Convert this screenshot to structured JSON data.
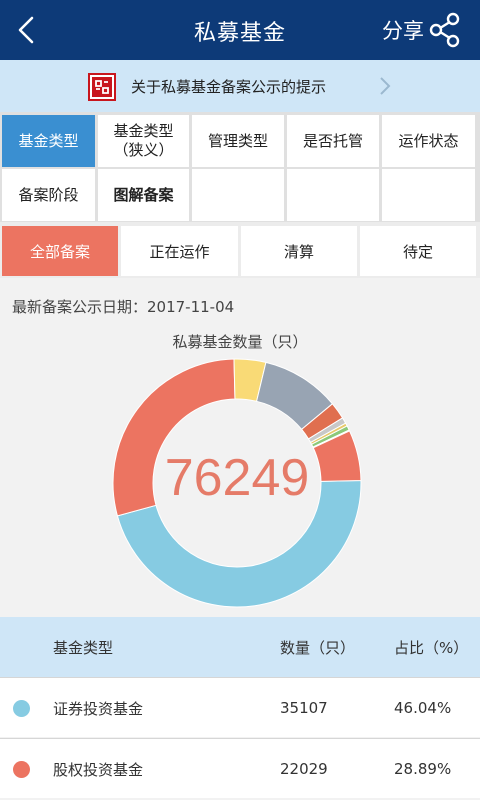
{
  "header": {
    "title": "私募基金",
    "share_label": "分享"
  },
  "notice": {
    "text": "关于私募基金备案公示的提示"
  },
  "category_tabs": [
    {
      "label": "基金类型",
      "active": true
    },
    {
      "label": "基金类型\n（狭义）"
    },
    {
      "label": "管理类型"
    },
    {
      "label": "是否托管"
    },
    {
      "label": "运作状态"
    },
    {
      "label": "备案阶段"
    },
    {
      "label": "图解备案",
      "bold": true
    }
  ],
  "filters": [
    {
      "label": "全部备案",
      "active": true
    },
    {
      "label": "正在运作"
    },
    {
      "label": "清算"
    },
    {
      "label": "待定"
    }
  ],
  "date_line": "最新备案公示日期：2017-11-04",
  "chart_title": "私募基金数量（只）",
  "total": "76249",
  "chart_data": {
    "type": "pie",
    "title": "私募基金数量（只）",
    "total": 76249,
    "slices": [
      {
        "value": 35107,
        "color": "#86cbe2"
      },
      {
        "value": 22029,
        "color": "#ec7461"
      },
      {
        "value": 3150,
        "color": "#f9da76"
      },
      {
        "value": 7800,
        "color": "#98a4b3"
      },
      {
        "value": 1700,
        "color": "#e06f4f"
      },
      {
        "value": 600,
        "color": "#c8c8c8"
      },
      {
        "value": 300,
        "color": "#e8c96a"
      },
      {
        "value": 450,
        "color": "#8cc97a"
      },
      {
        "value": 100,
        "color": "#ffffff"
      },
      {
        "value": 5013,
        "color": "#ec7461"
      }
    ]
  },
  "table": {
    "headers": {
      "name": "基金类型",
      "count": "数量（只）",
      "pct": "占比（%）"
    },
    "rows": [
      {
        "color": "#86cbe2",
        "name": "证券投资基金",
        "count": "35107",
        "pct": "46.04%"
      },
      {
        "color": "#ec7461",
        "name": "股权投资基金",
        "count": "22029",
        "pct": "28.89%"
      }
    ]
  },
  "icons": {
    "back": "back-arrow-icon",
    "share": "share-icon",
    "notice_logo": "amac-logo-icon",
    "notice_arrow": "chevron-right-icon"
  }
}
